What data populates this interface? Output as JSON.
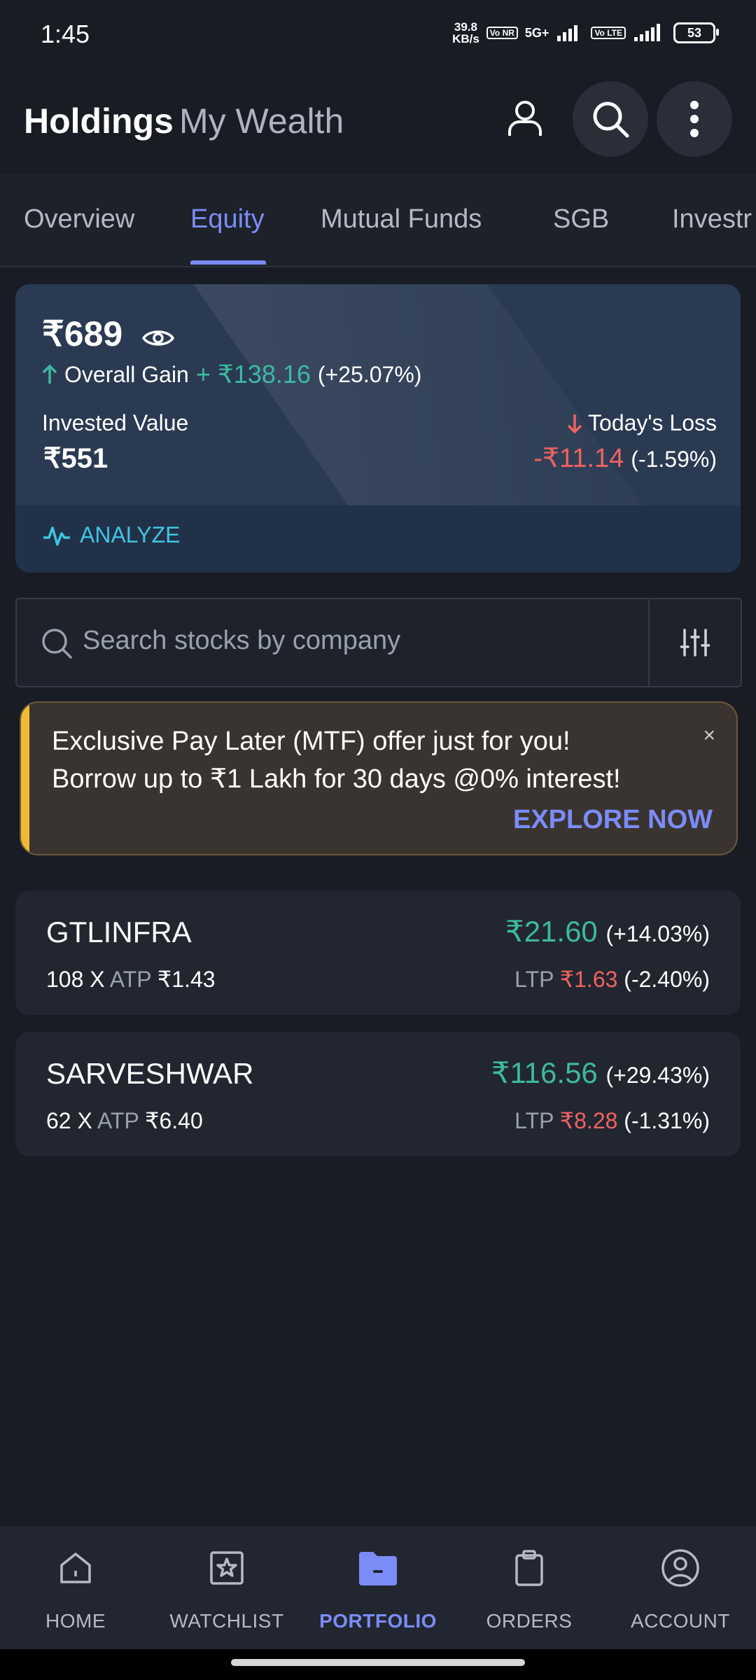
{
  "status": {
    "time": "1:45",
    "net_speed_value": "39.8",
    "net_speed_unit": "KB/s",
    "sim1_tag": "Vo NR",
    "network": "5G+",
    "sim2_tag": "Vo LTE",
    "battery": "53"
  },
  "header": {
    "title": "Holdings",
    "subtitle": "My Wealth",
    "icons": [
      "user-icon",
      "search-icon",
      "more-vertical-icon"
    ]
  },
  "tabs": [
    {
      "label": "Overview",
      "active": false
    },
    {
      "label": "Equity",
      "active": true
    },
    {
      "label": "Mutual Funds",
      "active": false
    },
    {
      "label": "SGB",
      "active": false
    },
    {
      "label": "Investr",
      "active": false
    }
  ],
  "summary": {
    "current_value": "₹689",
    "overall_gain_label": "Overall Gain",
    "overall_gain_value": "+ ₹138.16",
    "overall_gain_pct": "(+25.07%)",
    "invested_label": "Invested Value",
    "invested_value": "₹551",
    "today_label": "Today's Loss",
    "today_value": "-₹11.14",
    "today_pct": "(-1.59%)",
    "analyze_label": "ANALYZE"
  },
  "search": {
    "placeholder": "Search stocks by company"
  },
  "promo": {
    "line1": "Exclusive Pay Later (MTF) offer just for you!",
    "line2": "Borrow up to ₹1 Lakh for 30 days @0% interest!",
    "cta": "EXPLORE NOW",
    "close": "×"
  },
  "holdings": [
    {
      "name": "GTLINFRA",
      "qty": "108 X",
      "atp_label": "ATP",
      "atp": "₹1.43",
      "value": "₹21.60",
      "value_pct": "(+14.03%)",
      "ltp_label": "LTP",
      "ltp": "₹1.63",
      "ltp_pct": "(-2.40%)"
    },
    {
      "name": "SARVESHWAR",
      "qty": "62 X",
      "atp_label": "ATP",
      "atp": "₹6.40",
      "value": "₹116.56",
      "value_pct": "(+29.43%)",
      "ltp_label": "LTP",
      "ltp": "₹8.28",
      "ltp_pct": "(-1.31%)"
    }
  ],
  "nav": [
    {
      "label": "HOME",
      "icon": "home-icon",
      "active": false
    },
    {
      "label": "WATCHLIST",
      "icon": "watchlist-star-icon",
      "active": false
    },
    {
      "label": "PORTFOLIO",
      "icon": "portfolio-folder-icon",
      "active": true
    },
    {
      "label": "ORDERS",
      "icon": "orders-clipboard-icon",
      "active": false
    },
    {
      "label": "ACCOUNT",
      "icon": "account-icon",
      "active": false
    }
  ],
  "colors": {
    "accent": "#7b8cf7",
    "gain": "#3db9a0",
    "loss": "#f06262",
    "promo_stripe": "#f2b936",
    "background": "#191c24"
  }
}
